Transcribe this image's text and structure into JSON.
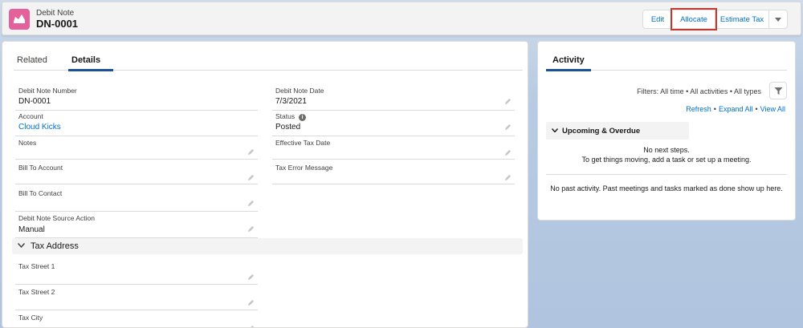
{
  "header": {
    "object_type": "Debit Note",
    "record_name": "DN-0001",
    "actions": [
      "Edit",
      "Allocate",
      "Estimate Tax"
    ]
  },
  "tabs": {
    "related": "Related",
    "details": "Details"
  },
  "fields": {
    "debit_note_number": {
      "label": "Debit Note Number",
      "value": "DN-0001"
    },
    "debit_note_date": {
      "label": "Debit Note Date",
      "value": "7/3/2021"
    },
    "account": {
      "label": "Account",
      "value": "Cloud Kicks"
    },
    "status": {
      "label": "Status",
      "value": "Posted"
    },
    "notes": {
      "label": "Notes",
      "value": ""
    },
    "effective_tax_date": {
      "label": "Effective Tax Date",
      "value": ""
    },
    "bill_to_account": {
      "label": "Bill To Account",
      "value": ""
    },
    "tax_error_message": {
      "label": "Tax Error Message",
      "value": ""
    },
    "bill_to_contact": {
      "label": "Bill To Contact",
      "value": ""
    },
    "source_action": {
      "label": "Debit Note Source Action",
      "value": "Manual"
    },
    "tax_street_1": {
      "label": "Tax Street 1",
      "value": ""
    },
    "tax_street_2": {
      "label": "Tax Street 2",
      "value": ""
    },
    "tax_city": {
      "label": "Tax City",
      "value": ""
    }
  },
  "tax_address_section": "Tax Address",
  "activity": {
    "tab": "Activity",
    "filters": "Filters: All time • All activities • All types",
    "links": {
      "refresh": "Refresh",
      "expand_all": "Expand All",
      "view_all": "View All"
    },
    "upcoming_title": "Upcoming & Overdue",
    "no_next_steps": "No next steps.",
    "get_moving": "To get things moving, add a task or set up a meeting.",
    "no_past": "No past activity. Past meetings and tasks marked as done show up here."
  },
  "colors": {
    "brand_icon": "#e3629b",
    "link": "#0070d2",
    "highlight_outline": "#c23934"
  }
}
